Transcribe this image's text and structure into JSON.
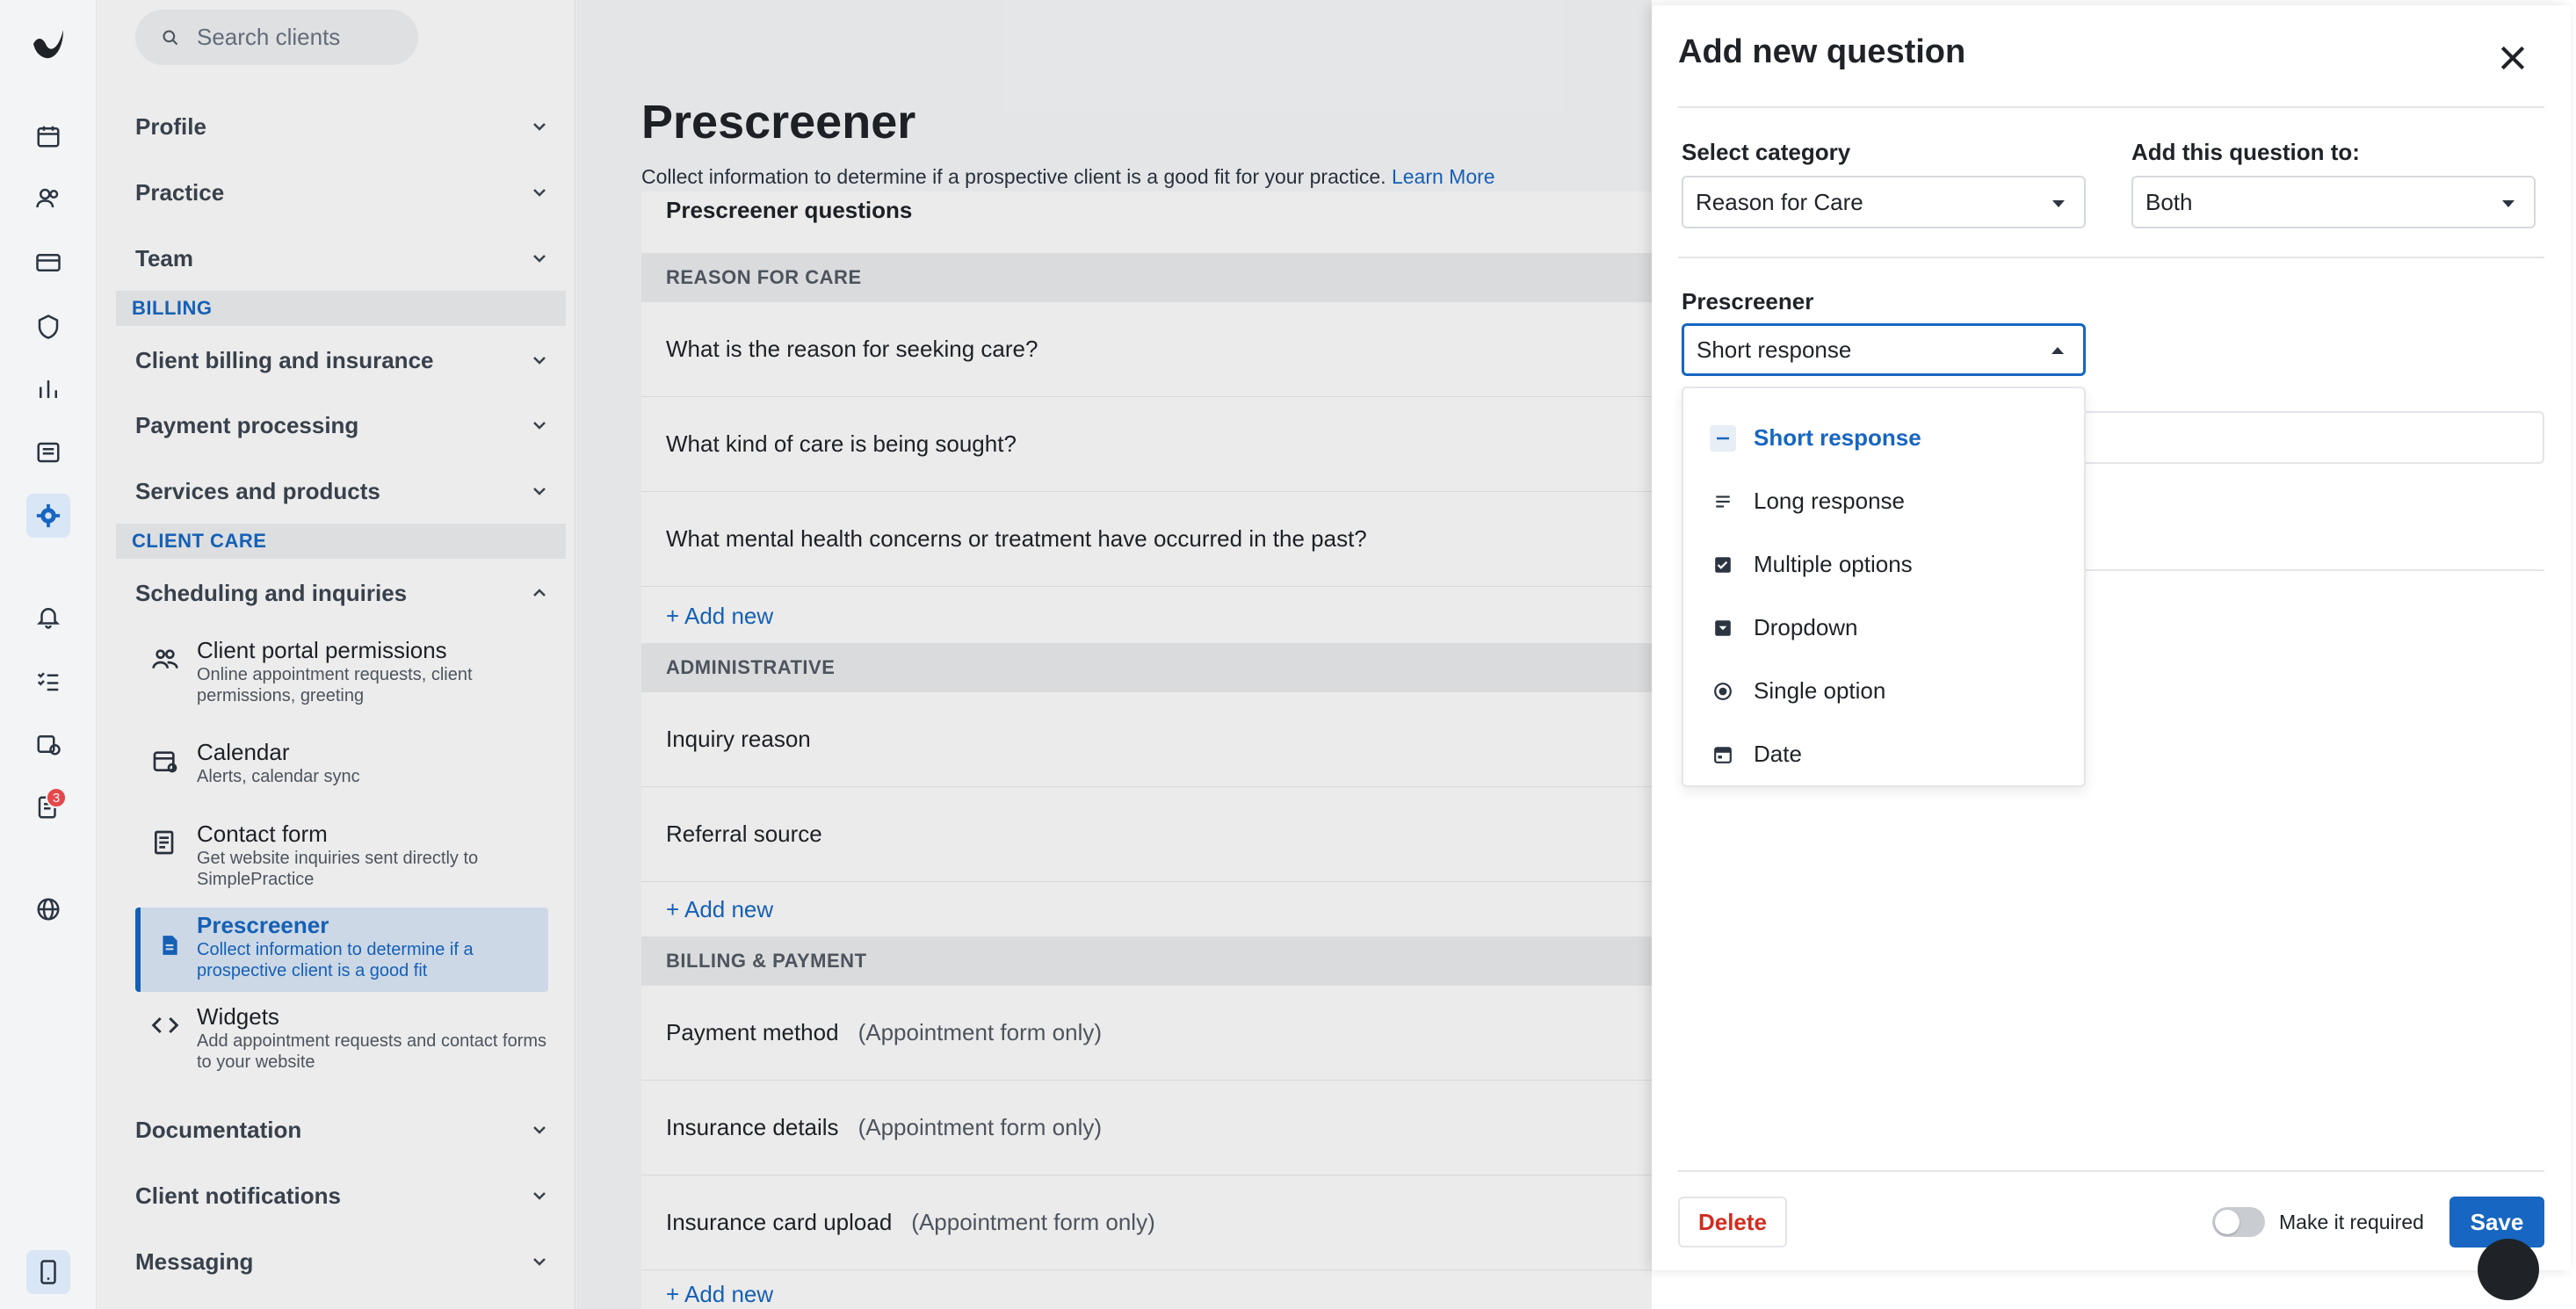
{
  "rail": {
    "badge_count": "3"
  },
  "nav": {
    "search_placeholder": "Search clients",
    "groups_top": [
      {
        "label": "Profile"
      },
      {
        "label": "Practice"
      },
      {
        "label": "Team"
      }
    ],
    "billing_section": "BILLING",
    "groups_billing": [
      {
        "label": "Client billing and insurance"
      },
      {
        "label": "Payment processing"
      },
      {
        "label": "Services and products"
      }
    ],
    "client_care_section": "CLIENT CARE",
    "scheduling_label": "Scheduling and inquiries",
    "sub_items": [
      {
        "title": "Client portal permissions",
        "desc": "Online appointment requests, client permissions, greeting"
      },
      {
        "title": "Calendar",
        "desc": "Alerts, calendar sync"
      },
      {
        "title": "Contact form",
        "desc": "Get website inquiries sent directly to SimplePractice"
      },
      {
        "title": "Prescreener",
        "desc": "Collect information to determine if a prospective client is a good fit"
      },
      {
        "title": "Widgets",
        "desc": "Add appointment requests and contact forms to your website"
      }
    ],
    "groups_bottom": [
      {
        "label": "Documentation"
      },
      {
        "label": "Client notifications"
      },
      {
        "label": "Messaging"
      }
    ]
  },
  "main": {
    "title": "Prescreener",
    "subtitle": "Collect information to determine if a prospective client is a good fit for your practice.",
    "learn_more": "Learn More",
    "card_title": "Prescreener questions",
    "add_new": "+ Add new",
    "groups": [
      {
        "header": "REASON FOR CARE",
        "questions": [
          {
            "text": "What is the reason for seeking care?",
            "note": ""
          },
          {
            "text": "What kind of care is being sought?",
            "note": ""
          },
          {
            "text": "What mental health concerns or treatment have occurred in the past?",
            "note": ""
          }
        ]
      },
      {
        "header": "ADMINISTRATIVE",
        "questions": [
          {
            "text": "Inquiry reason",
            "note": ""
          },
          {
            "text": "Referral source",
            "note": ""
          }
        ]
      },
      {
        "header": "BILLING & PAYMENT",
        "questions": [
          {
            "text": "Payment method",
            "note": "(Appointment form only)"
          },
          {
            "text": "Insurance details",
            "note": "(Appointment form only)"
          },
          {
            "text": "Insurance card upload",
            "note": "(Appointment form only)"
          }
        ]
      }
    ]
  },
  "panel": {
    "title": "Add new question",
    "category_label": "Select category",
    "category_value": "Reason for Care",
    "add_to_label": "Add this question to:",
    "add_to_value": "Both",
    "prescreener_label": "Prescreener",
    "type_value": "Short response",
    "type_options": [
      {
        "label": "Short response",
        "icon": "dash-icon",
        "selected": true
      },
      {
        "label": "Long response",
        "icon": "text-lines-icon",
        "selected": false
      },
      {
        "label": "Multiple options",
        "icon": "checkbox-icon",
        "selected": false
      },
      {
        "label": "Dropdown",
        "icon": "dropdown-icon",
        "selected": false
      },
      {
        "label": "Single option",
        "icon": "radio-icon",
        "selected": false
      },
      {
        "label": "Date",
        "icon": "calendar-icon",
        "selected": false
      }
    ],
    "delete_label": "Delete",
    "required_label": "Make it required",
    "required_on": false,
    "save_label": "Save"
  },
  "colors": {
    "accent": "#1766c1",
    "danger": "#d12c1f"
  }
}
